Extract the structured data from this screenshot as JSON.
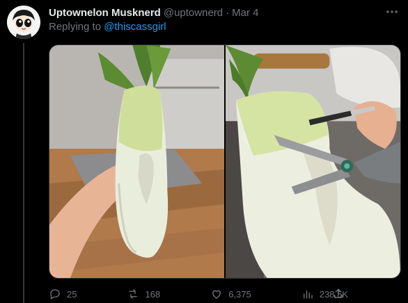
{
  "post": {
    "display_name": "Uptownelon Musknerd",
    "handle": "@uptownerd",
    "separator": "·",
    "date": "Mar 4",
    "reply_prefix": "Replying to",
    "reply_to": "@thiscassgirl"
  },
  "media": {
    "images": [
      {
        "icon": "daikon-radish-photo-left"
      },
      {
        "icon": "daikon-radish-photo-right"
      }
    ]
  },
  "actions": {
    "replies": "25",
    "reposts": "168",
    "likes": "6,375",
    "views": "238.5K"
  },
  "colors": {
    "background": "#000000",
    "text": "#e7e9ea",
    "muted": "#71767b",
    "link": "#1d9bf0",
    "border": "#2f3336"
  }
}
